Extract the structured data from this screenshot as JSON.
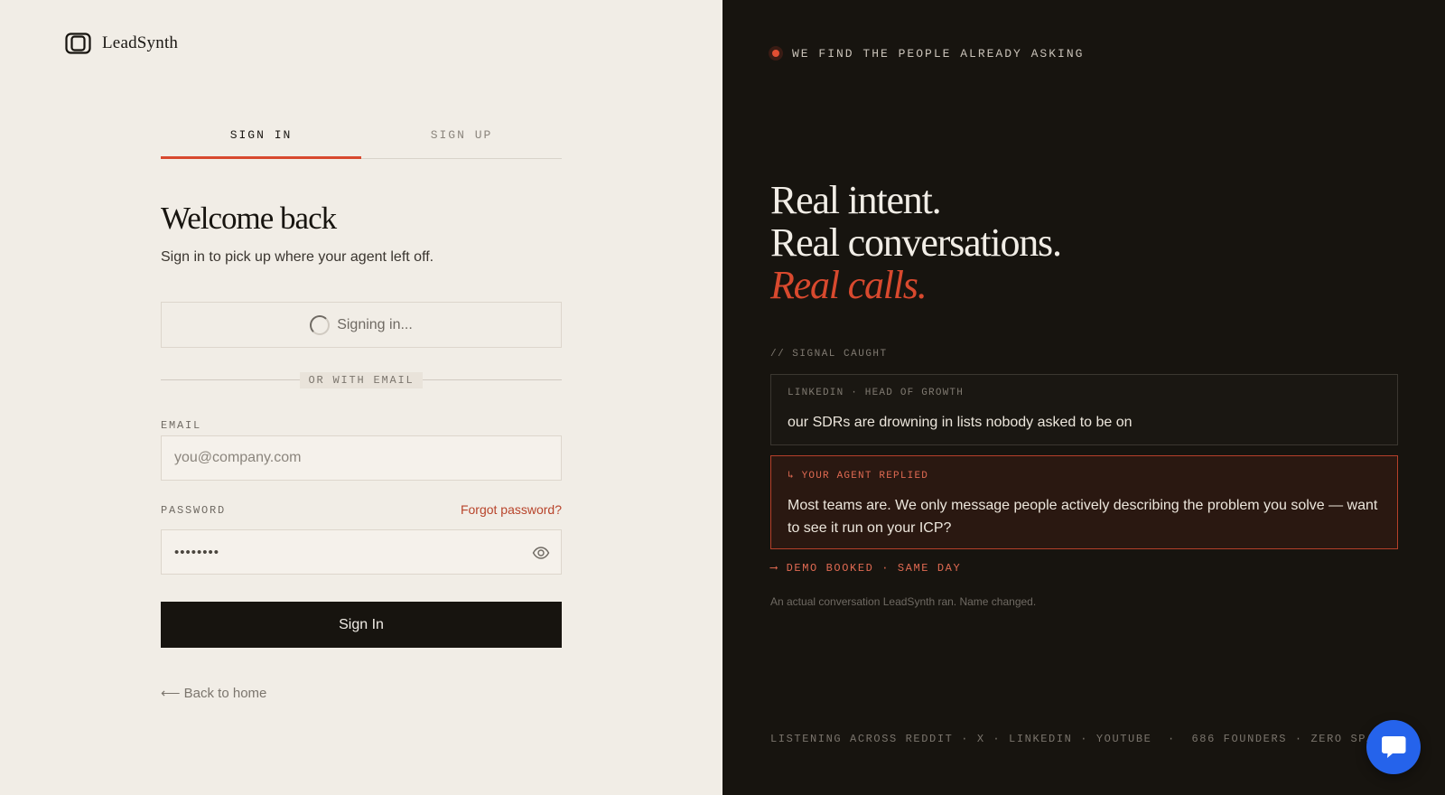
{
  "brand": {
    "name": "LeadSynth"
  },
  "tabs": [
    {
      "label": "SIGN IN"
    },
    {
      "label": "SIGN UP"
    }
  ],
  "form": {
    "title": "Welcome back",
    "subtitle": "Sign in to pick up where your agent left off.",
    "oauth_status": "Signing in...",
    "divider": "OR WITH EMAIL",
    "email_label": "EMAIL",
    "email_placeholder": "you@company.com",
    "password_label": "PASSWORD",
    "forgot": "Forgot password?",
    "password_value": "••••••••",
    "submit": "Sign In",
    "back": "⟵ Back to home"
  },
  "promo": {
    "tagline": "WE FIND THE PEOPLE ALREADY ASKING",
    "headline_1": "Real intent.",
    "headline_2": "Real conversations.",
    "headline_3": "Real calls.",
    "signal_label": "// SIGNAL CAUGHT",
    "card1_meta": "LINKEDIN · HEAD OF GROWTH",
    "card1_text": "our SDRs are drowning in lists nobody asked to be on",
    "card2_meta": "↳ YOUR AGENT REPLIED",
    "card2_text": "Most teams are. We only message people actively describing the problem you solve — want to see it run on your ICP?",
    "booked": "⟶ DEMO BOOKED · SAME DAY",
    "footnote": "An actual conversation LeadSynth ran. Name changed.",
    "listening": "LISTENING ACROSS REDDIT · X · LINKEDIN · YOUTUBE  ·  686 FOUNDERS · ZERO SPAM"
  },
  "colors": {
    "accent": "#d8492e",
    "dark": "#17140f",
    "light": "#f1ede6",
    "chat": "#2563eb"
  },
  "icons": {
    "logo": "logo-mark-icon",
    "spinner": "spinner-icon",
    "eye": "eye-icon",
    "chat": "chat-icon"
  }
}
